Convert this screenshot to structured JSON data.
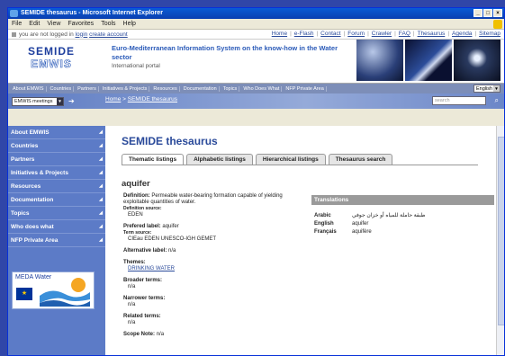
{
  "window": {
    "title": "SEMIDE thesaurus - Microsoft Internet Explorer"
  },
  "menu": [
    "File",
    "Edit",
    "View",
    "Favorites",
    "Tools",
    "Help"
  ],
  "userbar": {
    "status": "you are not logged in",
    "login": "login",
    "create": "create account",
    "links": [
      "Home",
      "e-Flash",
      "Contact",
      "Forum",
      "Crawler",
      "FAQ",
      "Thesaurus",
      "Agenda",
      "Sitemap"
    ]
  },
  "logo": {
    "line1": "SEMIDE",
    "line2": "EMWIS"
  },
  "banner": {
    "title": "Euro-Mediterranean Information System on the know-how in the Water sector",
    "subtitle": "International portal"
  },
  "navstrip": [
    "About EMWIS",
    "Countries",
    "Partners",
    "Initiatives & Projects",
    "Resources",
    "Documentation",
    "Topics",
    "Who Does What",
    "NFP Private Area"
  ],
  "language": "English",
  "meetings": "EMWIS meetings",
  "breadcrumb": {
    "home": "Home",
    "sep": " > ",
    "current": "SEMIDE thesaurus"
  },
  "search": {
    "placeholder": "search"
  },
  "sidebar": [
    "About EMWIS",
    "Countries",
    "Partners",
    "Initiatives & Projects",
    "Resources",
    "Documentation",
    "Topics",
    "Who does what",
    "NFP Private Area"
  ],
  "meda": {
    "title": "MEDA Water"
  },
  "page": {
    "title": "SEMIDE thesaurus"
  },
  "tabs": [
    "Thematic listings",
    "Alphabetic listings",
    "Hierarchical listings",
    "Thesaurus search"
  ],
  "term": {
    "name": "aquifer",
    "definition_label": "Definition:",
    "definition": "Permeable water-bearing formation capable of yielding exploitable quantities of water.",
    "def_source_label": "Definition source:",
    "def_source": "EDEN",
    "preferred_label_label": "Prefered label:",
    "preferred_label": "aquifer",
    "term_source_label": "Term source:",
    "term_source": "CIEau EDEN UNESCO-IGH GEMET",
    "alt_label_label": "Alternative label:",
    "alt_label": "n/a",
    "themes_label": "Themes:",
    "theme": "DRINKING WATER",
    "broader_label": "Broader terms:",
    "broader": "n/a",
    "narrower_label": "Narrower terms:",
    "narrower": "n/a",
    "related_label": "Related terms:",
    "related": "n/a",
    "scope_label": "Scope Note:",
    "scope": "n/a"
  },
  "translations": {
    "header": "Translations",
    "rows": [
      {
        "lang": "Arabic",
        "value": "طبقة حاملة للمياه أو خزان جوفي"
      },
      {
        "lang": "English",
        "value": "aquifer"
      },
      {
        "lang": "Français",
        "value": "aquifère"
      }
    ]
  },
  "colors": {
    "sidebar": "#5c7bc7",
    "title": "#2a4a9a",
    "desktop": "#3046a8"
  }
}
